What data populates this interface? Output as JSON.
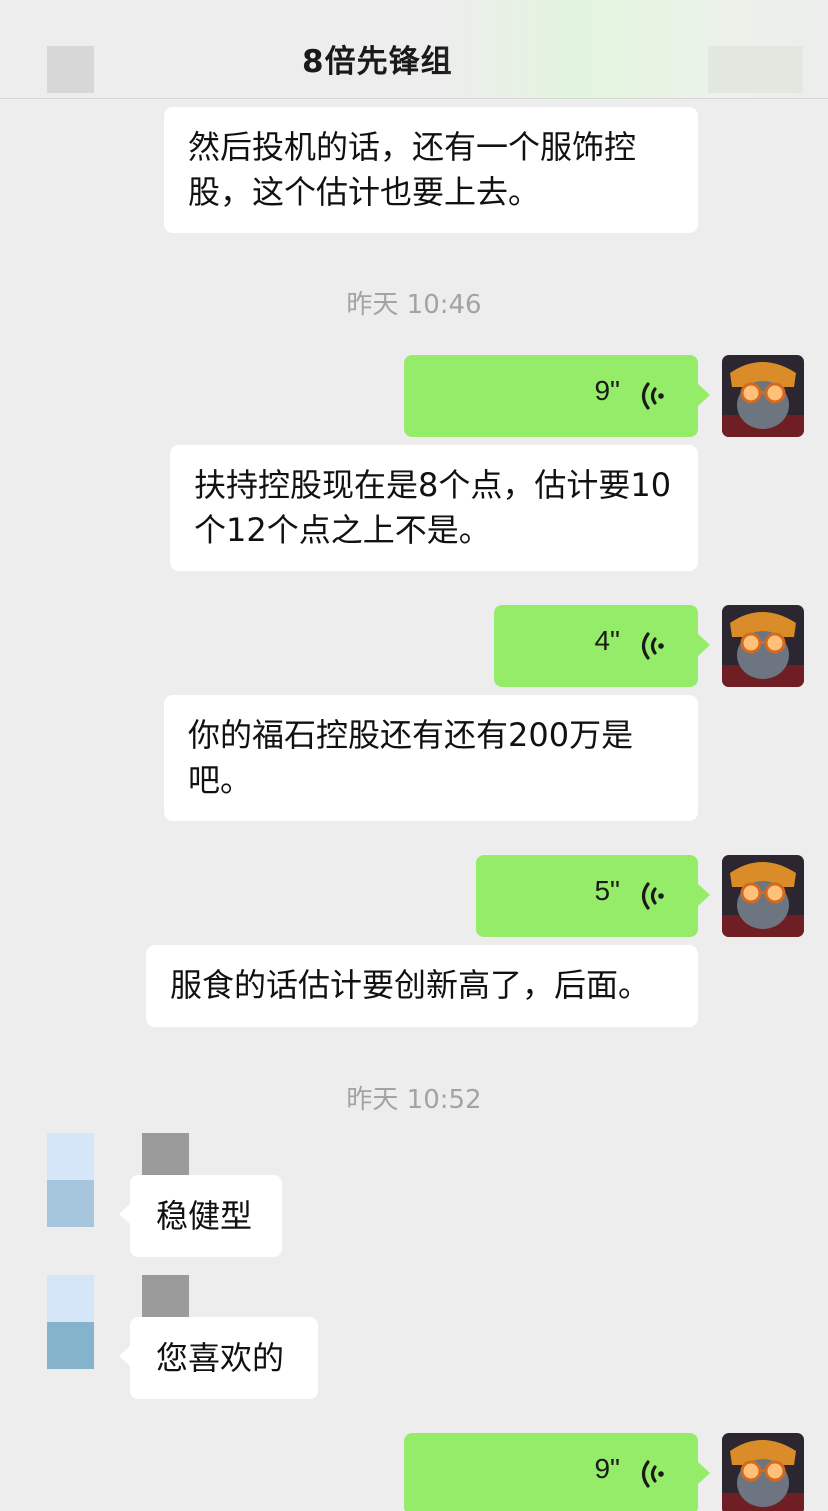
{
  "header": {
    "title": "8倍先锋组"
  },
  "messages": {
    "m1": "然后投机的话，还有一个服饰控股，这个估计也要上去。",
    "ts1": "昨天 10:46",
    "v1": "9\"",
    "m2": "扶持控股现在是8个点，估计要10个12个点之上不是。",
    "v2": "4\"",
    "m3": "你的福石控股还有还有200万是吧。",
    "v3": "5\"",
    "m4": "服食的话估计要创新高了，后面。",
    "ts2": "昨天 10:52",
    "l1": "稳健型",
    "l2": "您喜欢的",
    "v4": "9\""
  },
  "colors": {
    "background": "#ededed",
    "bubble_self": "#95ec69",
    "bubble_other": "#ffffff",
    "timestamp": "#a3a3a3"
  },
  "icons": {
    "voice": "voice-wave-icon",
    "avatar": "cat-avatar"
  }
}
